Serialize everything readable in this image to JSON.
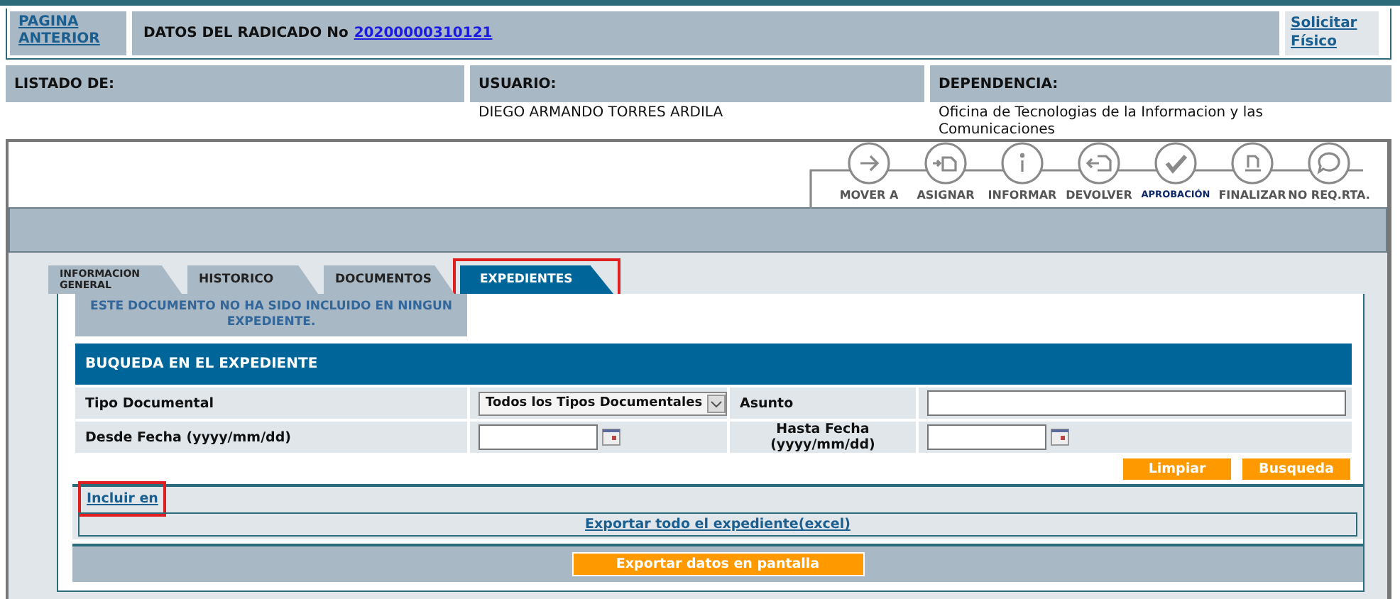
{
  "header": {
    "back_link": "PAGINA ANTERIOR",
    "title_label": "DATOS DEL RADICADO No",
    "radicado_link": "20200000310121",
    "request_link": "Solicitar Físico"
  },
  "info": [
    {
      "label": "LISTADO DE:"
    },
    {
      "label": "USUARIO:",
      "value": "DIEGO ARMANDO TORRES ARDILA"
    },
    {
      "label": "DEPENDENCIA:",
      "value": "Oficina de Tecnologias de la Informacion y las Comunicaciones"
    }
  ],
  "actions": [
    {
      "kind": "move",
      "label": "MOVER A"
    },
    {
      "kind": "assign",
      "label": "ASIGNAR"
    },
    {
      "kind": "inform",
      "label": "INFORMAR"
    },
    {
      "kind": "return",
      "label": "DEVOLVER"
    },
    {
      "kind": "approve",
      "label": "APROBACIÓN"
    },
    {
      "kind": "finish",
      "label": "FINALIZAR"
    },
    {
      "kind": "noreply",
      "label": "NO REQ.RTA."
    }
  ],
  "tabs": [
    {
      "label": "INFORMACION GENERAL",
      "selected": false,
      "highlighted": false
    },
    {
      "label": "HISTORICO",
      "selected": false,
      "highlighted": false
    },
    {
      "label": "DOCUMENTOS",
      "selected": false,
      "highlighted": false
    },
    {
      "label": "EXPEDIENTES",
      "selected": true,
      "highlighted": true
    }
  ],
  "expediente": {
    "notice": "ESTE DOCUMENTO NO HA SIDO INCLUIDO EN NINGUN EXPEDIENTE.",
    "search_title": "BUQUEDA EN EL EXPEDIENTE",
    "fields": [
      {
        "kind": "select",
        "label": "Tipo Documental",
        "value": "Todos los Tipos Documentales"
      },
      {
        "kind": "text",
        "label": "Asunto"
      },
      {
        "kind": "date",
        "label": "Desde Fecha (yyyy/mm/dd)"
      },
      {
        "kind": "date",
        "label": "Hasta Fecha (yyyy/mm/dd)"
      }
    ],
    "buttons": [
      "Limpiar",
      "Busqueda"
    ],
    "include_link": {
      "label": "Incluir en",
      "highlighted": true
    },
    "export_all_link": "Exportar todo el expediente(excel)",
    "export_screen_button": "Exportar datos en pantalla"
  }
}
